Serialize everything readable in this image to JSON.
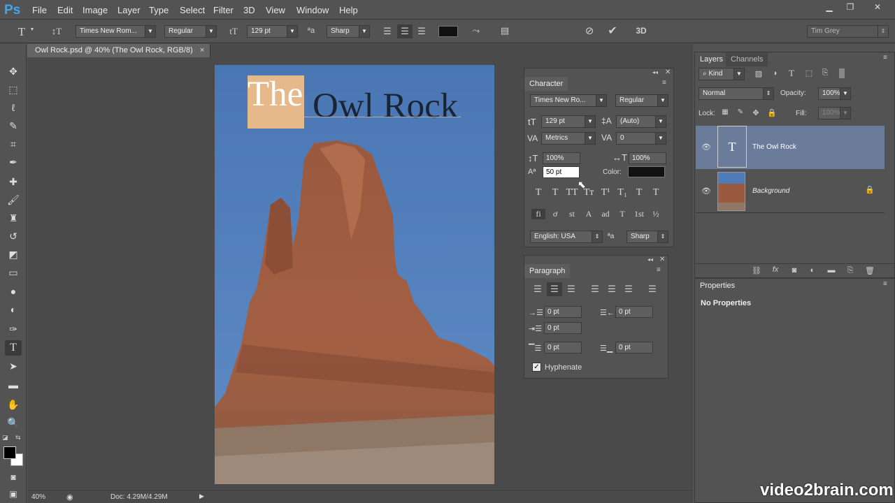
{
  "app": {
    "logo": "Ps"
  },
  "menu": [
    "File",
    "Edit",
    "Image",
    "Layer",
    "Type",
    "Select",
    "Filter",
    "3D",
    "View",
    "Window",
    "Help"
  ],
  "options": {
    "font_family": "Times New Rom...",
    "font_style": "Regular",
    "font_size": "129 pt",
    "antialias": "Sharp",
    "user": "Tim Grey"
  },
  "document": {
    "tab_title": "Owl Rock.psd @ 40% (The Owl Rock, RGB/8)",
    "close": "×",
    "text_first": "The",
    "text_rest": "Owl Rock"
  },
  "status": {
    "zoom": "40%",
    "doc_size": "Doc: 4.29M/4.29M"
  },
  "character": {
    "title": "Character",
    "font_family": "Times New Ro...",
    "font_style": "Regular",
    "font_size": "129 pt",
    "leading": "(Auto)",
    "kerning": "Metrics",
    "tracking": "0",
    "vscale": "100%",
    "hscale": "100%",
    "baseline": "50 pt",
    "color_label": "Color:",
    "language": "English: USA",
    "antialias": "Sharp",
    "styles": [
      "T",
      "T",
      "TT",
      "Tт",
      "T¹",
      "T₁",
      "T",
      "T"
    ],
    "opentype": [
      "fi",
      "ơ",
      "st",
      "A",
      "ad",
      "T",
      "1st",
      "½"
    ]
  },
  "paragraph": {
    "title": "Paragraph",
    "indent_left": "0 pt",
    "indent_right": "0 pt",
    "indent_first": "0 pt",
    "space_before": "0 pt",
    "space_after": "0 pt",
    "hyphenate": "Hyphenate"
  },
  "layers": {
    "tab": "Layers",
    "tab2": "Channels",
    "filter": "Kind",
    "blend": "Normal",
    "opacity_label": "Opacity:",
    "opacity": "100%",
    "lock_label": "Lock:",
    "fill_label": "Fill:",
    "fill": "100%",
    "items": [
      {
        "name": "The Owl Rock",
        "thumb": "T"
      },
      {
        "name": "Background"
      }
    ]
  },
  "properties": {
    "tab": "Properties",
    "empty": "No Properties"
  },
  "watermark": "video2brain.com",
  "colors": {
    "accent": "#3ea8f5",
    "selected_layer": "#6a7c99",
    "text_highlight": "#e6b98a"
  }
}
